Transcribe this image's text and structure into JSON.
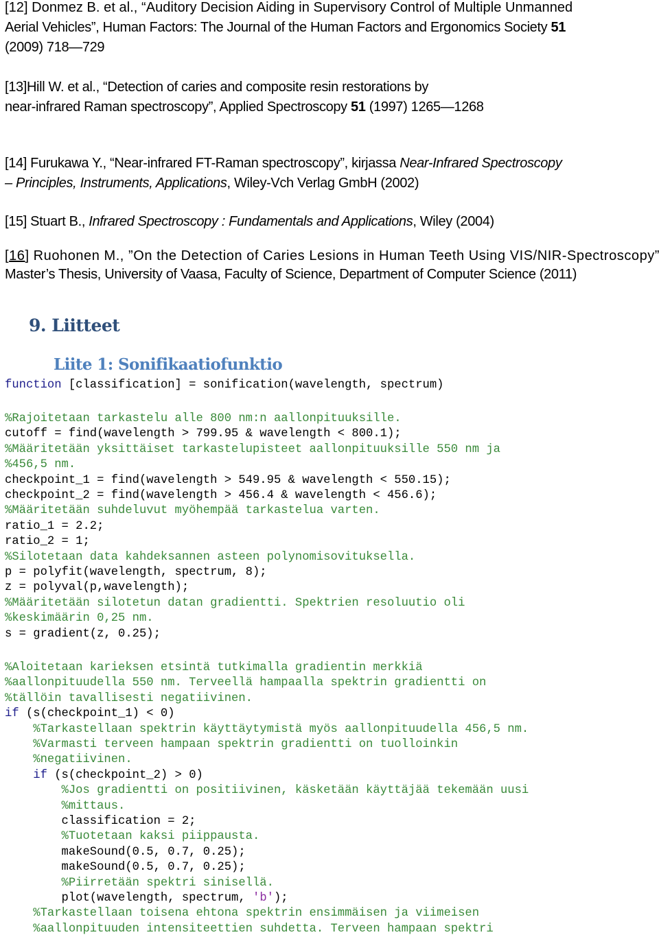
{
  "references": [
    {
      "id": "ref-12",
      "lines": [
        [
          "[12] Donmez B. et al., “Auditory Decision Aiding in Supervisory Control of Multiple Unmanned"
        ],
        [
          "Aerial Vehicles”, Human Factors: The Journal of the Human Factors and Ergonomics Society ",
          "51"
        ],
        [
          "(2009) 718—729"
        ]
      ]
    },
    {
      "id": "ref-13",
      "line1": "[13]Hill W. et al., “Detection of caries and composite resin restorations by",
      "line2_pre": "near-infrared Raman spectroscopy”,  Applied Spectroscopy ",
      "line2_bold": "51",
      "line2_post": " (1997) 1265—1268"
    },
    {
      "id": "ref-14",
      "line1_pre": "[14] Furukawa Y., “Near-infrared FT-Raman spectroscopy”, kirjassa ",
      "line1_italic": "Near-Infrared Spectroscopy",
      "line2_italic": "– Principles, Instruments, Applications",
      "line2_post": ", Wiley-Vch Verlag GmbH (2002)"
    },
    {
      "id": "ref-15",
      "pre": "[15] Stuart B., ",
      "italic": "Infrared Spectroscopy : Fundamentals and Applications",
      "post": ", Wiley (2004)"
    },
    {
      "id": "ref-16",
      "bracket_open": "[",
      "num": "16",
      "line1_post": "] Ruohonen M., ”On the Detection of Caries Lesions in Human Teeth Using VIS/NIR-Spectroscopy”,",
      "line2": "Master’s Thesis, University of Vaasa, Faculty of Science, Department of Computer Science (2011)"
    }
  ],
  "ref12": {
    "line1": "[12] Donmez B. et al., “Auditory Decision Aiding in Supervisory Control of Multiple Unmanned",
    "line2_pre": "Aerial Vehicles”, Human Factors: The Journal of the Human Factors and Ergonomics Society ",
    "line2_bold": "51",
    "line3": "(2009) 718—729"
  },
  "section_heading": "9. Liitteet",
  "subsection_heading": "Liite 1: Sonifikaatiofunktio",
  "code": {
    "l01_kw": "function",
    "l01": " [classification] = sonification(wavelength, spectrum)",
    "l02": "%Rajoitetaan tarkastelu alle 800 nm:n aallonpituuksille.",
    "l03": "cutoff = find(wavelength > 799.95 & wavelength < 800.1);",
    "l04": "%Määritetään yksittäiset tarkastelupisteet aallonpituuksille 550 nm ja",
    "l05": "%456,5 nm.",
    "l06": "checkpoint_1 = find(wavelength > 549.95 & wavelength < 550.15);",
    "l07": "checkpoint_2 = find(wavelength > 456.4 & wavelength < 456.6);",
    "l08": "%Määritetään suhdeluvut myöhempää tarkastelua varten.",
    "l09": "ratio_1 = 2.2;",
    "l10": "ratio_2 = 1;",
    "l11": "%Silotetaan data kahdeksannen asteen polynomisovituksella.",
    "l12": "p = polyfit(wavelength, spectrum, 8);",
    "l13": "z = polyval(p,wavelength);",
    "l14": "%Määritetään silotetun datan gradientti. Spektrien resoluutio oli",
    "l15": "%keskimäärin 0,25 nm.",
    "l16": "s = gradient(z, 0.25);",
    "l17": "%Aloitetaan karieksen etsintä tutkimalla gradientin merkkiä",
    "l18": "%aallonpituudella 550 nm. Terveellä hampaalla spektrin gradientti on",
    "l19": "%tällöin tavallisesti negatiivinen.",
    "l20_kw": "if",
    "l20": " (s(checkpoint_1) < 0)",
    "l21": "    %Tarkastellaan spektrin käyttäytymistä myös aallonpituudella 456,5 nm.",
    "l22": "    %Varmasti terveen hampaan spektrin gradientti on tuolloinkin",
    "l23": "    %negatiivinen.",
    "l24_indent": "    ",
    "l24_kw": "if",
    "l24": " (s(checkpoint_2) > 0)",
    "l25": "        %Jos gradientti on positiivinen, käsketään käyttäjää tekemään uusi",
    "l26": "        %mittaus.",
    "l27": "        classification = 2;",
    "l28": "        %Tuotetaan kaksi piippausta.",
    "l29": "        makeSound(0.5, 0.7, 0.25);",
    "l30": "        makeSound(0.5, 0.7, 0.25);",
    "l31": "        %Piirretään spektri sinisellä.",
    "l32_pre": "        plot(wavelength, spectrum, ",
    "l32_str": "'b'",
    "l32_post": ");",
    "l33": "    %Tarkastellaan toisena ehtona spektrin ensimmäisen ja viimeisen",
    "l34": "    %aallonpituuden intensiteettien suhdetta. Terveen hampaan spektri"
  },
  "colors": {
    "section_heading": "#2f4f7a",
    "subsection_heading": "#4f81bd",
    "code_keyword": "#1e1e8c",
    "code_comment": "#3a8a3a",
    "code_string": "#8a2aa0"
  }
}
